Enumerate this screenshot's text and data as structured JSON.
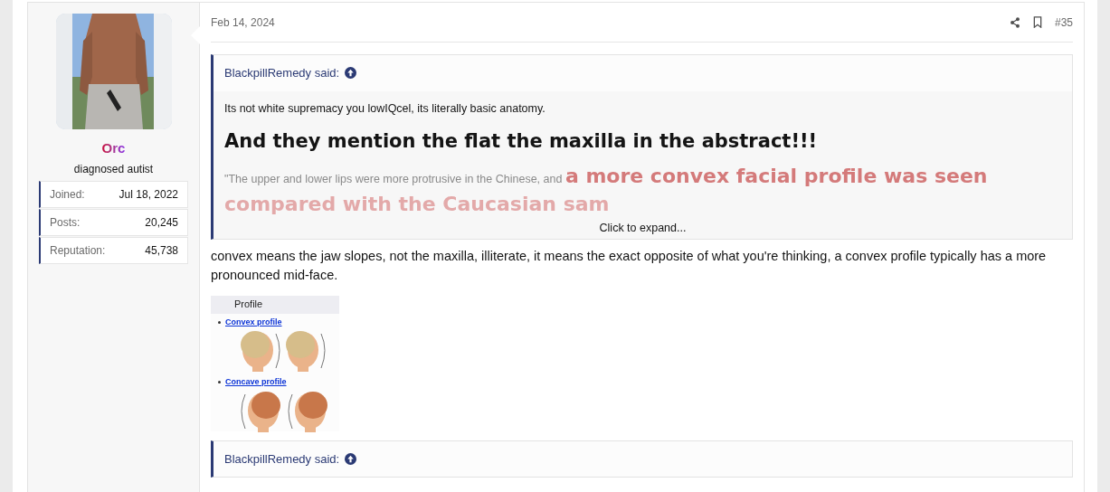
{
  "user": {
    "name": "Orc",
    "title": "diagnosed autist",
    "stats": [
      {
        "label": "Joined:",
        "value": "Jul 18, 2022"
      },
      {
        "label": "Posts:",
        "value": "20,245"
      },
      {
        "label": "Reputation:",
        "value": "45,738"
      }
    ]
  },
  "post": {
    "date": "Feb 14, 2024",
    "number": "#35",
    "quote": {
      "author": "BlackpillRemedy said:",
      "paragraphs": [
        {
          "kind": "plain",
          "text": "Its not white supremacy you lowIQcel, its literally basic anatomy."
        },
        {
          "kind": "heading",
          "text": "And they mention the flat the maxilla in the abstract!!!"
        },
        {
          "kind": "mixed",
          "lead": "\"The upper and lower lips were more protrusive in the Chinese, and",
          "emphasis": "a more convex facial profile was seen",
          "continuation": "compared with the Caucasian sam"
        }
      ],
      "expand": "Click to expand..."
    },
    "body": "convex means the jaw slopes, not the maxilla, illiterate, it means the exact opposite of what you're thinking, a convex profile typically has a more pronounced mid-face.",
    "image": {
      "title": "Profile",
      "sections": [
        {
          "kind": "convex",
          "label": "Convex profile"
        },
        {
          "kind": "concave",
          "label": "Concave profile"
        }
      ]
    },
    "next_quote": {
      "author": "BlackpillRemedy said:"
    }
  }
}
